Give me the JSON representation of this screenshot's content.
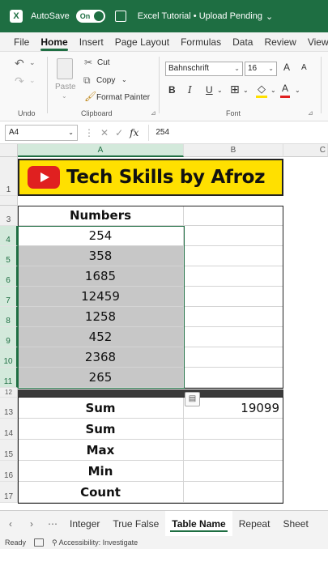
{
  "titlebar": {
    "autosave_label": "AutoSave",
    "autosave_state": "On",
    "file_title": "Excel Tutorial • Upload Pending",
    "title_chevron": "⌄"
  },
  "ribbon_tabs": [
    "File",
    "Home",
    "Insert",
    "Page Layout",
    "Formulas",
    "Data",
    "Review",
    "View"
  ],
  "active_tab": "Home",
  "ribbon": {
    "undo_group": "Undo",
    "clipboard_group": "Clipboard",
    "font_group": "Font",
    "paste_label": "Paste",
    "cut_label": "Cut",
    "copy_label": "Copy",
    "format_painter_label": "Format Painter",
    "font_name": "Bahnschrift",
    "font_size": "16",
    "bold": "B",
    "italic": "I",
    "underline": "U"
  },
  "formula_bar": {
    "name_box": "A4",
    "fx": "fx",
    "value": "254"
  },
  "columns": [
    "A",
    "B",
    "C"
  ],
  "banner_text": "Tech Skills by Afroz",
  "rows": [
    {
      "num": "1"
    },
    {
      "num": "3",
      "a": "Numbers",
      "b": ""
    },
    {
      "num": "4",
      "a": "254",
      "b": ""
    },
    {
      "num": "5",
      "a": "358",
      "b": ""
    },
    {
      "num": "6",
      "a": "1685",
      "b": ""
    },
    {
      "num": "7",
      "a": "12459",
      "b": ""
    },
    {
      "num": "8",
      "a": "1258",
      "b": ""
    },
    {
      "num": "9",
      "a": "452",
      "b": ""
    },
    {
      "num": "10",
      "a": "2368",
      "b": ""
    },
    {
      "num": "11",
      "a": "265",
      "b": ""
    },
    {
      "num": "12"
    },
    {
      "num": "13",
      "a": "Sum",
      "b": "19099"
    },
    {
      "num": "14",
      "a": "Sum",
      "b": ""
    },
    {
      "num": "15",
      "a": "Max",
      "b": ""
    },
    {
      "num": "16",
      "a": "Min",
      "b": ""
    },
    {
      "num": "17",
      "a": "Count",
      "b": ""
    }
  ],
  "sheet_tabs": [
    "Integer",
    "True False",
    "Table Name",
    "Repeat",
    "Sheet"
  ],
  "active_sheet": "Table Name",
  "statusbar": {
    "ready": "Ready",
    "accessibility": "Accessibility: Investigate"
  },
  "colors": {
    "excel_green": "#1e6e42",
    "banner_yellow": "#ffe000",
    "youtube_red": "#e02020",
    "selection_gray": "#c7c7c7"
  }
}
